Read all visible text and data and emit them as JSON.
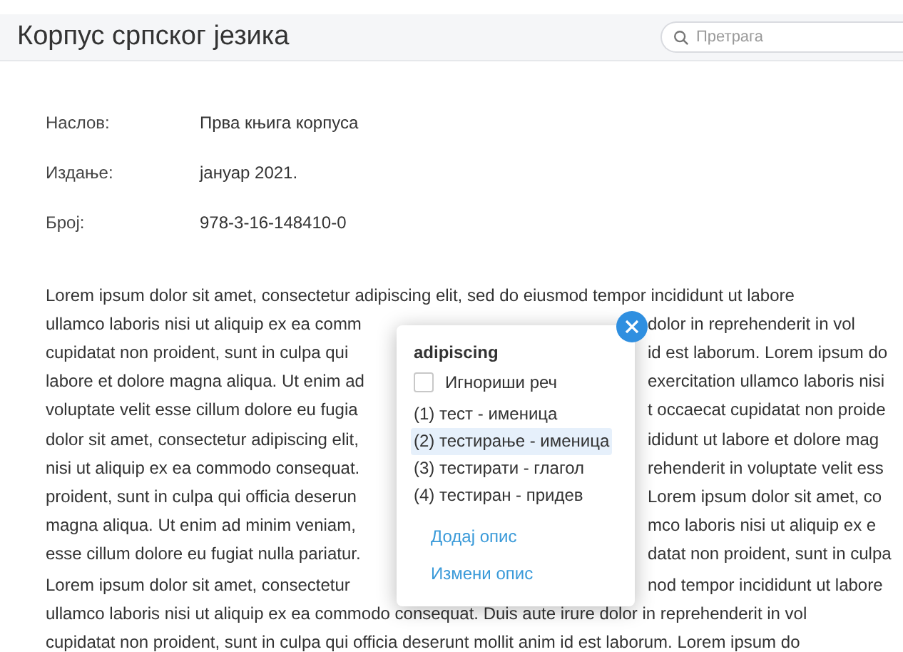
{
  "header": {
    "title": "Корпус српског језика",
    "search": {
      "placeholder": "Претрага"
    }
  },
  "details": [
    {
      "label": "Наслов:",
      "value": "Прва књига корпуса"
    },
    {
      "label": "Издање:",
      "value": "јануар 2021."
    },
    {
      "label": "Број:",
      "value": "978-3-16-148410-0"
    }
  ],
  "paragraphs": [
    {
      "lines": [
        {
          "segments": [
            "Lorem ipsum dolor sit amet, consectetur adipiscing elit, sed do eiusmod tempor incididunt ut labore"
          ]
        },
        {
          "segments": [
            "ullamco laboris nisi ut aliquip ex ea comm",
            "dolor in reprehenderit in vol"
          ]
        },
        {
          "segments": [
            "cupidatat non proident, sunt in culpa qui",
            "id est laborum. Lorem ipsum do"
          ]
        },
        {
          "segments": [
            "labore et dolore magna aliqua. Ut enim ad",
            "exercitation ullamco laboris nisi"
          ]
        },
        {
          "segments": [
            "voluptate velit esse cillum dolore eu fugia",
            "t occaecat cupidatat non proide"
          ]
        },
        {
          "segments": [
            "dolor sit amet, consectetur adipiscing elit,",
            "ididunt ut labore et dolore mag"
          ]
        },
        {
          "segments": [
            "nisi ut aliquip ex ea commodo consequat.",
            "rehenderit in voluptate velit ess"
          ]
        },
        {
          "segments": [
            "proident, sunt in culpa qui officia deserun",
            "Lorem ipsum dolor sit amet, co"
          ]
        },
        {
          "segments": [
            "magna aliqua. Ut enim ad minim veniam,",
            "mco laboris nisi ut aliquip ex e"
          ]
        },
        {
          "segments": [
            "esse cillum dolore eu fugiat nulla pariatur.",
            "datat non proident, sunt in culpa"
          ]
        }
      ]
    },
    {
      "lines": [
        {
          "segments": [
            "Lorem ipsum dolor sit amet, consectetur",
            "nod tempor incididunt ut labore"
          ]
        },
        {
          "segments": [
            "ullamco laboris nisi ut aliquip ex ea commodo consequat. Duis aute irure dolor in reprehenderit in vol"
          ]
        },
        {
          "segments": [
            "cupidatat non proident, sunt in culpa qui officia deserunt mollit anim id est laborum. Lorem ipsum do"
          ]
        }
      ]
    }
  ],
  "popup": {
    "word": "adipiscing",
    "ignore": {
      "label": "Игнориши реч",
      "checked": false
    },
    "options": [
      {
        "label": "(1) тест - именица",
        "selected": false
      },
      {
        "label": "(2) тестирање - именица",
        "selected": true
      },
      {
        "label": "(3) тестирати - глагол",
        "selected": false
      },
      {
        "label": "(4) тестиран - придев",
        "selected": false
      }
    ],
    "links": [
      "Додај опис",
      "Измени опис"
    ]
  }
}
